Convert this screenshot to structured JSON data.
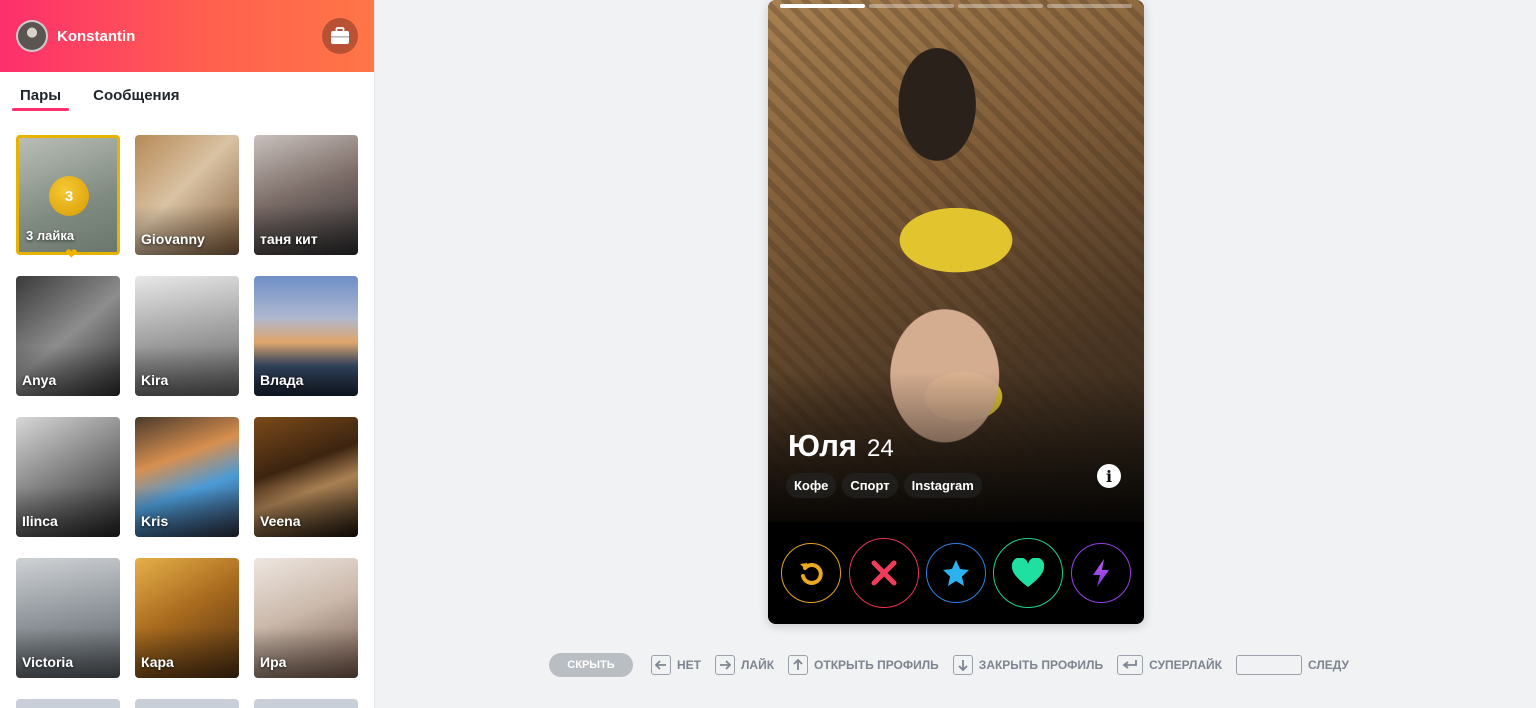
{
  "user": {
    "name": "Konstantin"
  },
  "tabs": [
    {
      "label": "Пары",
      "active": true
    },
    {
      "label": "Сообщения",
      "active": false
    }
  ],
  "likes_card": {
    "count": "3",
    "label": "3 лайка"
  },
  "matches": [
    {
      "name": "Giovanny"
    },
    {
      "name": "таня кит"
    },
    {
      "name": "Anya"
    },
    {
      "name": "Kira"
    },
    {
      "name": "Влада"
    },
    {
      "name": "Ilinca"
    },
    {
      "name": "Kris"
    },
    {
      "name": "Veena"
    },
    {
      "name": "Victoria"
    },
    {
      "name": "Кара"
    },
    {
      "name": "Ира"
    }
  ],
  "profile": {
    "name": "Юля",
    "age": "24",
    "tags": [
      "Кофе",
      "Спорт",
      "Instagram"
    ],
    "photo_index": 1,
    "photo_count": 4
  },
  "actions": [
    {
      "id": "rewind",
      "icon": "rewind-icon",
      "color": "#e4a21f"
    },
    {
      "id": "nope",
      "icon": "x-icon",
      "color": "#e8344d"
    },
    {
      "id": "super-like",
      "icon": "star-icon",
      "color": "#2db2f0"
    },
    {
      "id": "like",
      "icon": "heart-icon",
      "color": "#1fe0a0"
    },
    {
      "id": "boost",
      "icon": "lightning-icon",
      "color": "#9440e6"
    }
  ],
  "hints": {
    "hide": "СКРЫТЬ",
    "no": "НЕТ",
    "like": "ЛАЙК",
    "open_profile": "ОТКРЫТЬ ПРОФИЛЬ",
    "close_profile": "ЗАКРЫТЬ ПРОФИЛЬ",
    "superlike": "СУПЕРЛАЙК",
    "next": "СЛЕДУ"
  },
  "colors": {
    "brand_gradient_start": "#fd2f6c",
    "brand_gradient_end": "#ff7647",
    "likes_gold": "#e5b300"
  }
}
